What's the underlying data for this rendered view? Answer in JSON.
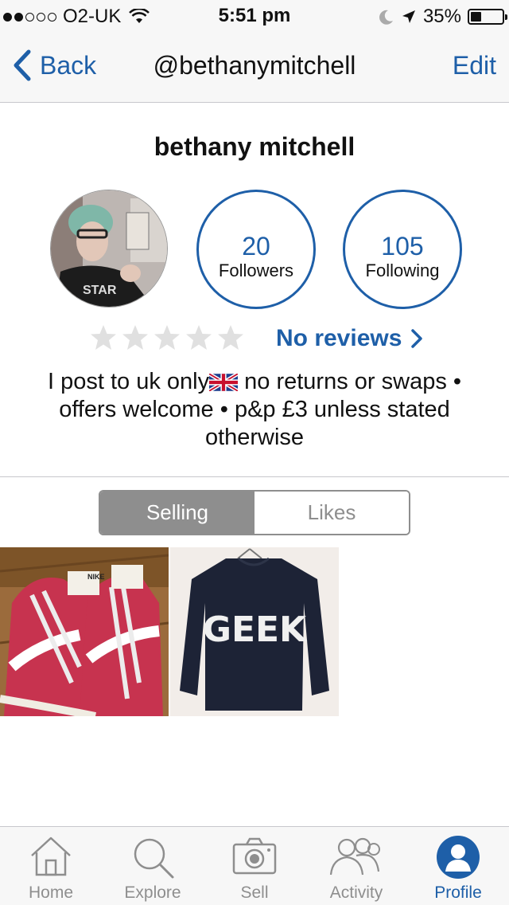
{
  "status_bar": {
    "carrier": "O2-UK",
    "time": "5:51 pm",
    "battery": "35%",
    "battery_level": 0.35,
    "signal_bars_filled": 2,
    "signal_bars_total": 5
  },
  "nav": {
    "back_label": "Back",
    "title": "@bethanymitchell",
    "edit_label": "Edit"
  },
  "profile": {
    "name": "bethany mitchell",
    "followers_count": "20",
    "followers_label": "Followers",
    "following_count": "105",
    "following_label": "Following",
    "rating_stars": 0,
    "reviews_label": "No reviews",
    "bio_part1": "I post to uk only",
    "bio_part2": " no returns or swaps • offers welcome • p&p £3 unless stated otherwise"
  },
  "segments": {
    "selling": "Selling",
    "likes": "Likes",
    "active": "Selling"
  },
  "items": [
    {
      "name": "red-nike-blazer-sneakers-photo",
      "text": "NIKE"
    },
    {
      "name": "navy-geek-sweatshirt-photo",
      "text": "GEEK"
    }
  ],
  "tab_bar": {
    "tabs": [
      {
        "label": "Home",
        "icon": "home-icon"
      },
      {
        "label": "Explore",
        "icon": "search-icon"
      },
      {
        "label": "Sell",
        "icon": "camera-icon"
      },
      {
        "label": "Activity",
        "icon": "people-icon"
      },
      {
        "label": "Profile",
        "icon": "profile-icon"
      }
    ],
    "active": "Profile"
  },
  "colors": {
    "accent": "#1e5fa8",
    "segment_gray": "#8e8e8e",
    "star_gray": "#e0e0e0",
    "bar_background": "#f7f7f7"
  }
}
